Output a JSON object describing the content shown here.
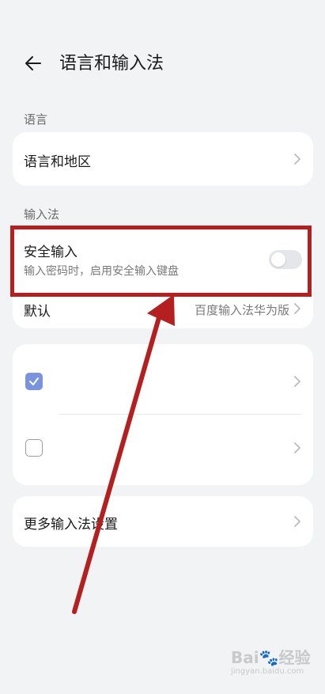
{
  "header": {
    "title": "语言和输入法"
  },
  "language_section": {
    "label": "语言",
    "item": "语言和地区"
  },
  "input_section": {
    "label": "输入法",
    "secure_input": {
      "title": "安全输入",
      "subtitle": "输入密码时，启用安全输入键盘",
      "enabled": false
    },
    "default": {
      "label": "默认",
      "value": "百度输入法华为版"
    },
    "keyboards": [
      {
        "checked": true
      },
      {
        "checked": false
      }
    ]
  },
  "more": {
    "label": "更多输入法设置"
  },
  "watermark": {
    "brand": "Bai",
    "site": "jingyan.baidu.com",
    "suffix": "经验"
  },
  "colors": {
    "background": "#f1f3f5",
    "card": "#ffffff",
    "annotation": "#b4201f",
    "checkbox_checked": "#7a93de"
  }
}
